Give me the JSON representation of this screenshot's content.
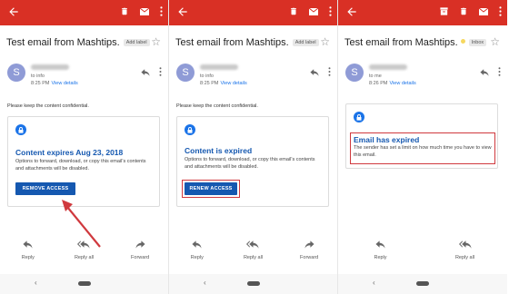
{
  "colors": {
    "topbar": "#d93025",
    "link": "#1a73e8",
    "card_title": "#1558b0",
    "highlight": "#d0393e",
    "avatar": "#8f9bd6"
  },
  "panels": [
    {
      "subject": "Test email from Mashtips.",
      "label": "Add label",
      "avatar_letter": "S",
      "to": "to info",
      "time": "8:25 PM",
      "view_details": "View details",
      "keep": "Please keep the content confidential.",
      "card_title": "Content expires Aug 23, 2018",
      "card_desc": "Options to forward, download, or copy this email's contents and attachments will be disabled.",
      "button": "REMOVE ACCESS"
    },
    {
      "subject": "Test email from Mashtips.",
      "label": "Add label",
      "avatar_letter": "S",
      "to": "to info",
      "time": "8:25 PM",
      "view_details": "View details",
      "keep": "Please keep the content confidential.",
      "card_title": "Content is expired",
      "card_desc": "Options to forward, download, or copy this email's contents and attachments will be disabled.",
      "button": "RENEW ACCESS"
    },
    {
      "subject": "Test email from Mashtips.",
      "label": "Inbox",
      "avatar_letter": "S",
      "to": "to me",
      "time": "8:26 PM",
      "view_details": "View details",
      "card_title": "Email has expired",
      "card_desc": "The sender has set a limit on how much time you have to view this email."
    }
  ],
  "actions": {
    "reply": "Reply",
    "reply_all": "Reply all",
    "forward": "Forward"
  }
}
